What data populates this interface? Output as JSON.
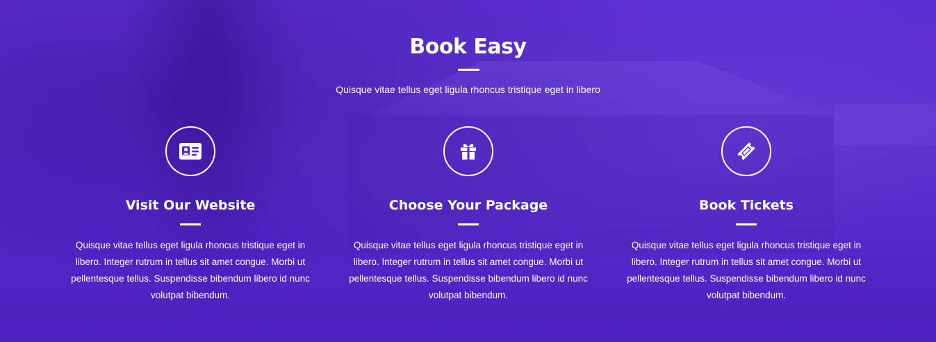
{
  "section": {
    "title": "Book Easy",
    "subtitle": "Quisque vitae tellus eget ligula rhoncus tristique eget in libero",
    "accent_color": "#5327c9"
  },
  "features": [
    {
      "icon": "id-card-icon",
      "title": "Visit Our Website",
      "text": "Quisque vitae tellus eget ligula rhoncus tristique eget in libero. Integer rutrum in tellus sit amet congue. Morbi ut pellentesque tellus. Suspendisse bibendum libero id nunc volutpat bibendum."
    },
    {
      "icon": "gift-icon",
      "title": "Choose Your Package",
      "text": "Quisque vitae tellus eget ligula rhoncus tristique eget in libero. Integer rutrum in tellus sit amet congue. Morbi ut pellentesque tellus. Suspendisse bibendum libero id nunc volutpat bibendum."
    },
    {
      "icon": "ticket-icon",
      "title": "Book Tickets",
      "text": "Quisque vitae tellus eget ligula rhoncus tristique eget in libero. Integer rutrum in tellus sit amet congue. Morbi ut pellentesque tellus. Suspendisse bibendum libero id nunc volutpat bibendum."
    }
  ]
}
